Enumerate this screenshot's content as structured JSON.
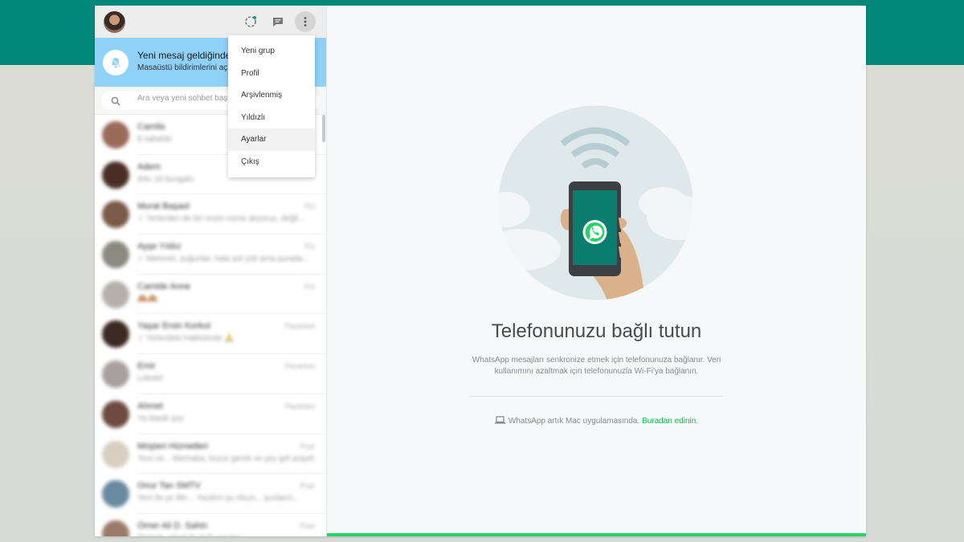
{
  "colors": {
    "brand": "#00897b",
    "notification_bg": "#8fd1f7",
    "link": "#07bc4c",
    "progress": "#25d366"
  },
  "header": {
    "avatar_icon": "user-avatar",
    "icons": [
      "status-icon",
      "new-chat-icon",
      "menu-icon"
    ]
  },
  "notification": {
    "icon": "bell-off-icon",
    "title": "Yeni mesaj geldiğinde b",
    "subtitle": "Masaüstü bildirimlerini aç"
  },
  "search": {
    "icon": "search-icon",
    "placeholder": "Ara veya yeni sohbet başl"
  },
  "menu": {
    "items": [
      {
        "label": "Yeni grup"
      },
      {
        "label": "Profil"
      },
      {
        "label": "Arşivlenmiş"
      },
      {
        "label": "Yıldızlı"
      },
      {
        "label": "Ayarlar"
      },
      {
        "label": "Çıkış"
      }
    ]
  },
  "chats": [
    {
      "name": "Camila",
      "message": "8 sabahki",
      "time": "",
      "color": "#9a6a5a"
    },
    {
      "name": "Adem",
      "message": "Arkı 18 bungalo",
      "time": "",
      "color": "#4a2e26"
    },
    {
      "name": "Murat Başaol",
      "message": "✓ Yerlerden de bir resim esme alıyoruz, değil...",
      "time": "Pzt",
      "color": "#7a5a48"
    },
    {
      "name": "Ayşe Yıldız",
      "message": "✓ Mehmet, şuğunlar, hala şöt yok ama şurada...",
      "time": "Pzt",
      "color": "#8a8a80"
    },
    {
      "name": "Camide Anne",
      "message": "🙈🙈",
      "time": "Pzt",
      "color": "#b5b0aa"
    },
    {
      "name": "Yaşar Ersin Korkut",
      "message": "✓ Yerlerdeki Hakkılerde 🙏",
      "time": "Pazartesi",
      "color": "#3a2a22"
    },
    {
      "name": "Emir",
      "message": "Lekelel",
      "time": "Pazartesi",
      "color": "#a8a0a0"
    },
    {
      "name": "Ahmet",
      "message": "Ya klasik şey",
      "time": "Pazartesi",
      "color": "#6e4a40"
    },
    {
      "name": "Müşteri Hizmetleri",
      "message": "Yeni ne... Merhaba, huzur gerek ve şey göl arayel...",
      "time": "Pzar",
      "color": "#d8cfc2"
    },
    {
      "name": "Onur Tan SMTV",
      "message": "Yeni ile ye lilin... Yazdım şu olsun... şunların...",
      "time": "Pzar",
      "color": "#6a8aa0"
    },
    {
      "name": "Ömer Ali D. Sahin",
      "message": "Elektrik şirketi ile ilgili yapılan...",
      "time": "Pzar",
      "color": "#9a7a6a"
    }
  ],
  "main": {
    "illustration": "phone-connected-illustration",
    "title": "Telefonunuzu bağlı tutun",
    "description": "WhatsApp mesajları senkronize etmek için telefonunuza bağlanır. Veri kullanımını azaltmak için telefonunuzla Wi-Fi'ya bağlanın.",
    "mac_icon": "laptop-icon",
    "mac_text": "WhatsApp artık Mac uygulamasında.",
    "mac_link": "Buradan edinin",
    "mac_suffix": "."
  }
}
